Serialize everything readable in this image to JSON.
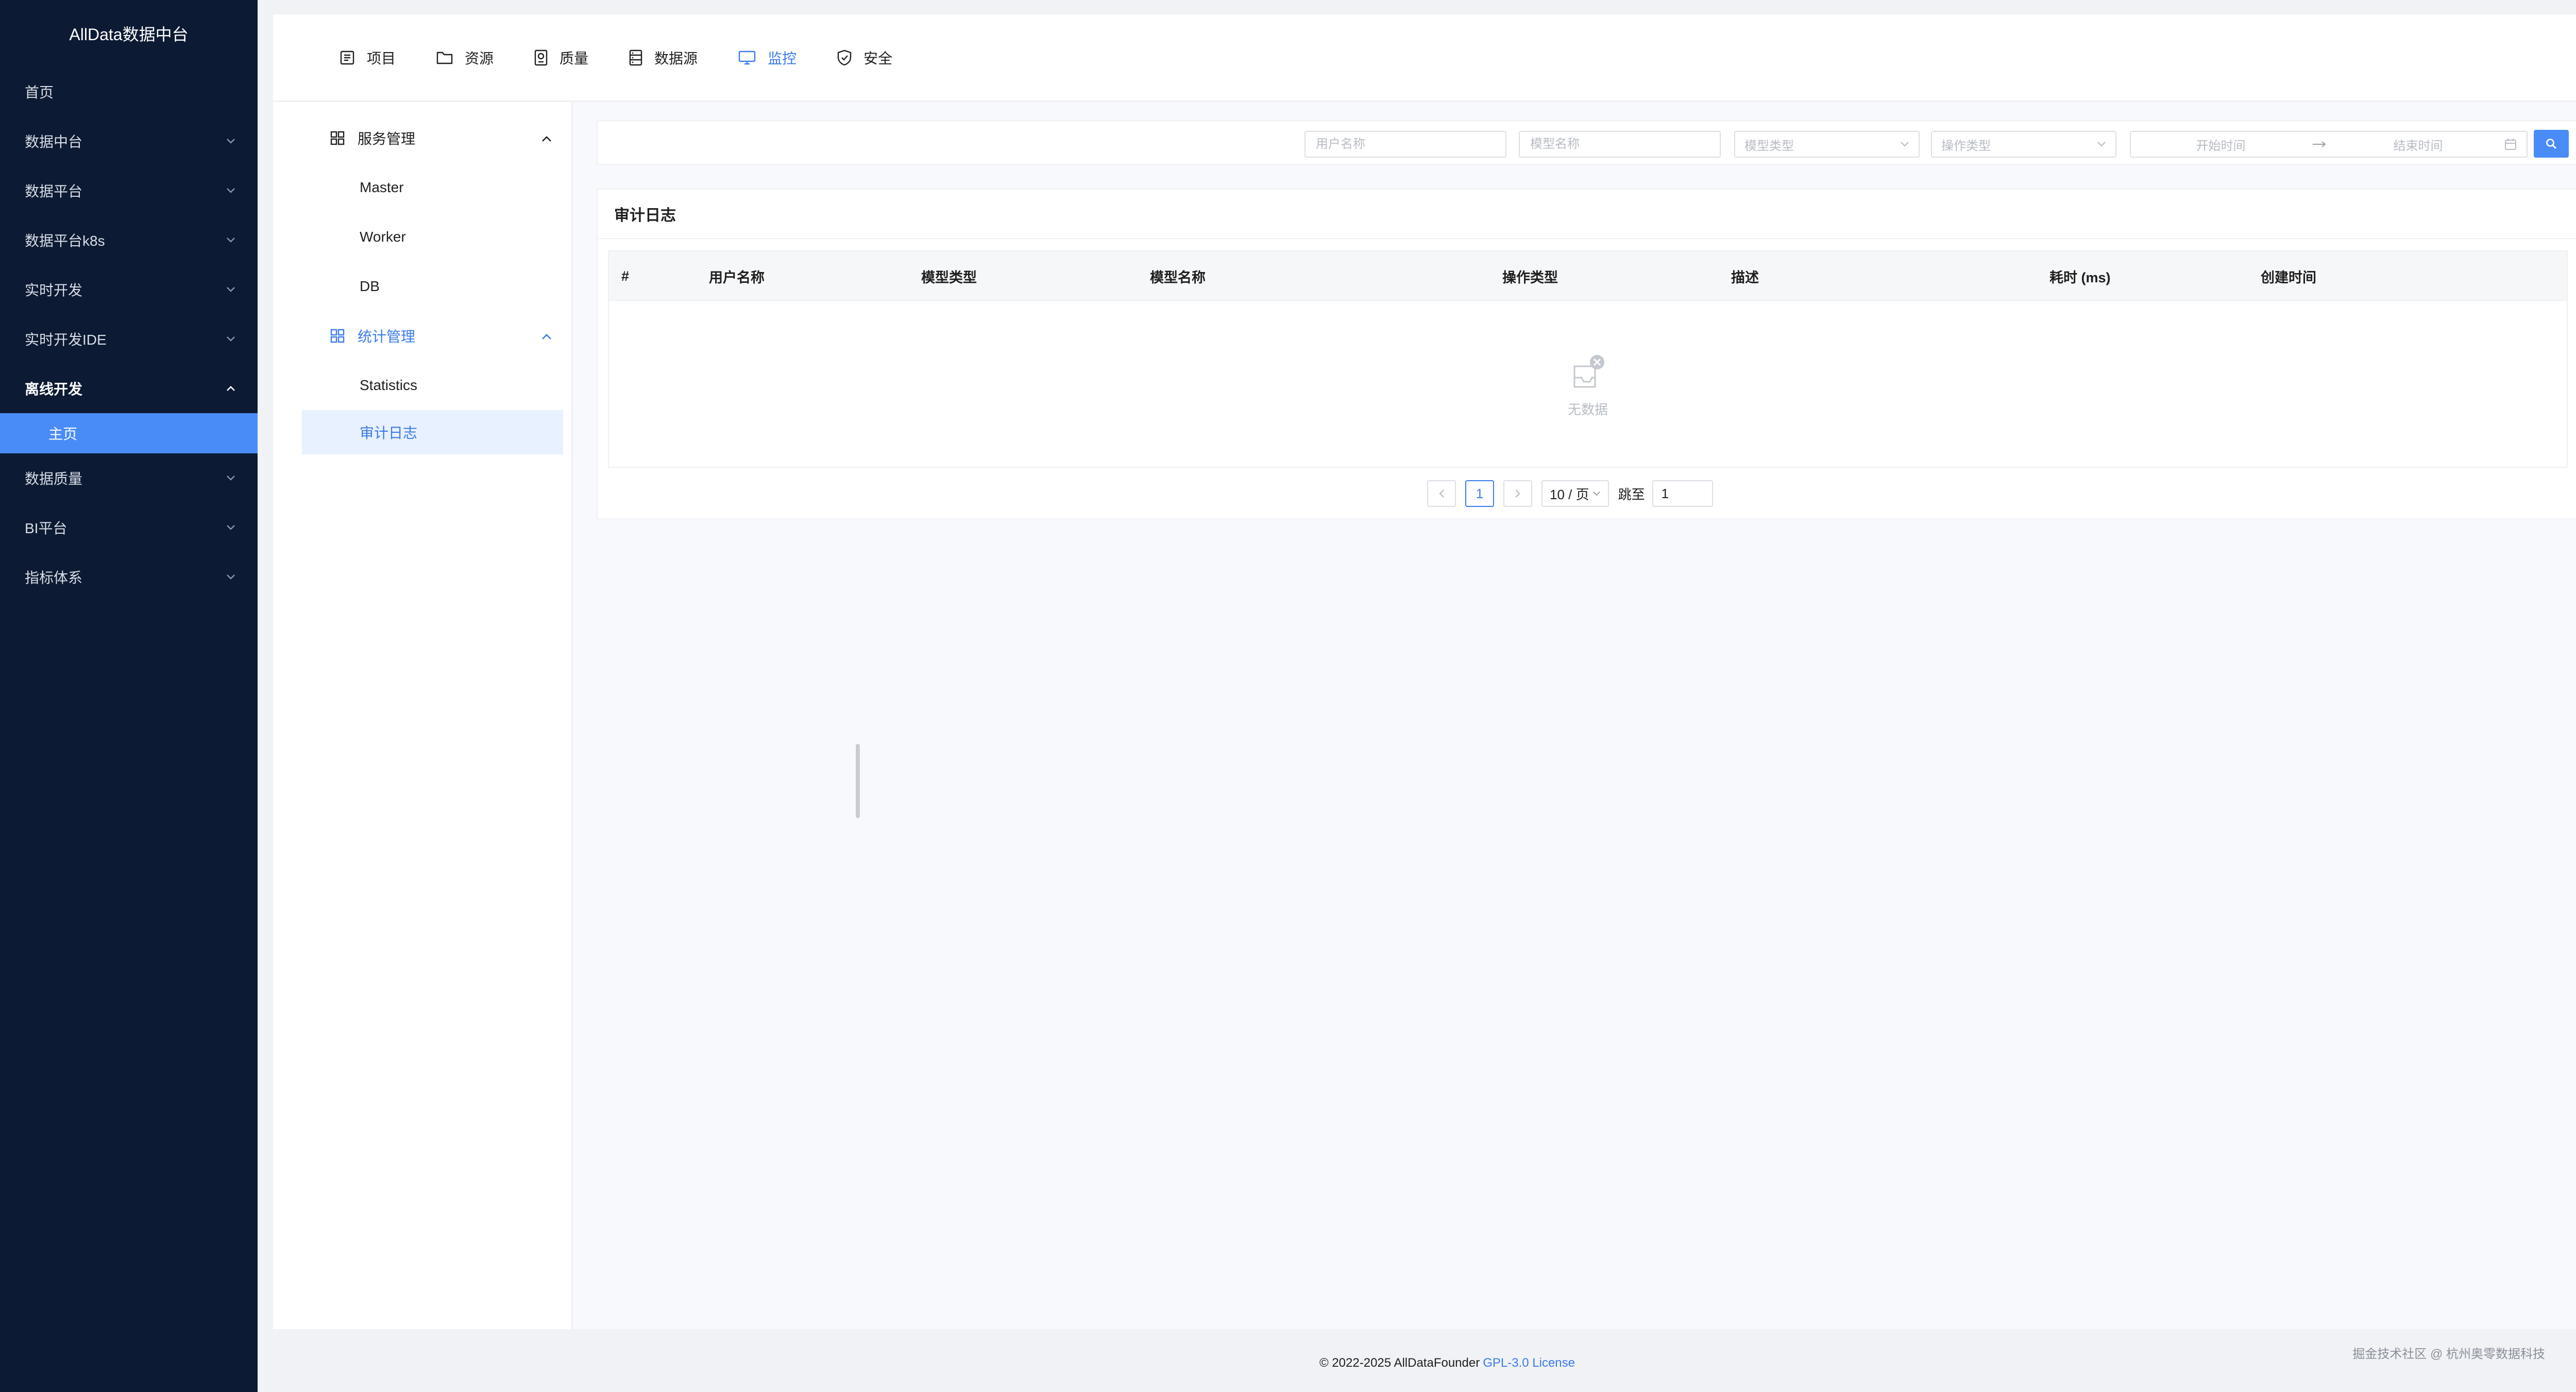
{
  "app": {
    "title": "AllData数据中台"
  },
  "sidebar": {
    "items": [
      {
        "label": "首页",
        "chevron": false
      },
      {
        "label": "数据中台",
        "chevron": true
      },
      {
        "label": "数据平台",
        "chevron": true
      },
      {
        "label": "数据平台k8s",
        "chevron": true
      },
      {
        "label": "实时开发",
        "chevron": true
      },
      {
        "label": "实时开发IDE",
        "chevron": true
      },
      {
        "label": "离线开发",
        "chevron": true,
        "open": true
      },
      {
        "label": "数据质量",
        "chevron": true
      },
      {
        "label": "BI平台",
        "chevron": true
      },
      {
        "label": "指标体系",
        "chevron": true
      }
    ],
    "sub_active": "主页"
  },
  "topnav": {
    "tabs": [
      {
        "label": "项目",
        "icon": "project-icon"
      },
      {
        "label": "资源",
        "icon": "folder-icon"
      },
      {
        "label": "质量",
        "icon": "quality-icon"
      },
      {
        "label": "数据源",
        "icon": "datasource-icon"
      },
      {
        "label": "监控",
        "icon": "monitor-icon",
        "active": true
      },
      {
        "label": "安全",
        "icon": "shield-icon"
      }
    ]
  },
  "submenu": {
    "group1": {
      "label": "服务管理",
      "items": [
        "Master",
        "Worker",
        "DB"
      ]
    },
    "group2": {
      "label": "统计管理",
      "items": [
        "Statistics",
        "审计日志"
      ],
      "active_item": "审计日志"
    }
  },
  "filters": {
    "user_placeholder": "用户名称",
    "model_name_placeholder": "模型名称",
    "model_type_placeholder": "模型类型",
    "op_type_placeholder": "操作类型",
    "start_placeholder": "开始时间",
    "end_placeholder": "结束时间"
  },
  "table": {
    "title": "审计日志",
    "columns": [
      "#",
      "用户名称",
      "模型类型",
      "模型名称",
      "操作类型",
      "描述",
      "耗时 (ms)",
      "创建时间"
    ],
    "empty_text": "无数据"
  },
  "pagination": {
    "current_page": "1",
    "page_size": "10 / 页",
    "jump_label": "跳至",
    "jump_value": "1"
  },
  "footer": {
    "copyright": "© 2022-2025 AllDataFounder",
    "license": "GPL-3.0 License",
    "watermark": "掘金技术社区 @ 杭州奥零数据科技"
  },
  "colors": {
    "sidebar_bg": "#0c1a33",
    "accent": "#3a7bea",
    "active_sub_bg": "#4a8cf7"
  }
}
